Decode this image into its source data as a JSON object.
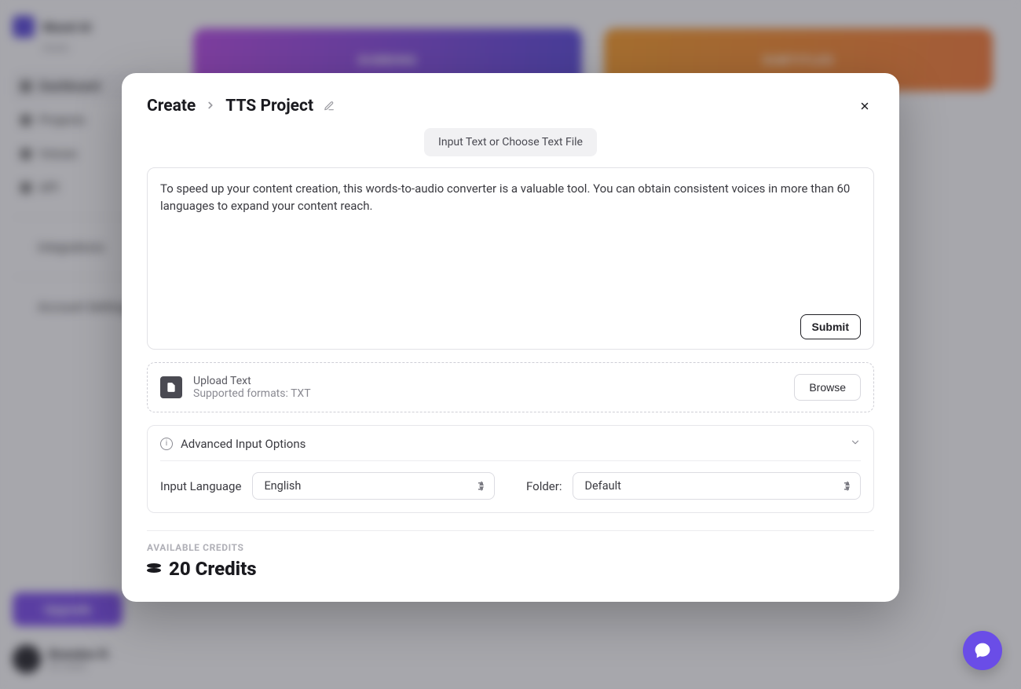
{
  "background": {
    "brand": "Wavel AI",
    "sub": "Studio",
    "nav": [
      "Dashboard",
      "Projects",
      "Voices",
      "API",
      "Integrations",
      "Account Settings"
    ],
    "upgrade": "Upgrade",
    "user_name": "Brandon R.",
    "user_credits": "20 credits",
    "card_a": "DUBBING",
    "card_b": "SUBTITLES"
  },
  "modal": {
    "breadcrumb_root": "Create",
    "breadcrumb_leaf": "TTS Project",
    "pill": "Input Text or Choose Text File",
    "text_value": "To speed up your content creation, this words-to-audio converter is a valuable tool. You can obtain consistent voices in more than 60 languages to expand your content reach.",
    "submit": "Submit",
    "upload_title": "Upload Text",
    "upload_sub": "Supported formats: TXT",
    "browse": "Browse",
    "advanced_title": "Advanced Input Options",
    "lang_label": "Input Language",
    "lang_value": "English",
    "folder_label": "Folder:",
    "folder_value": "Default",
    "credits_label": "AVAILABLE CREDITS",
    "credits_value": "20 Credits"
  }
}
